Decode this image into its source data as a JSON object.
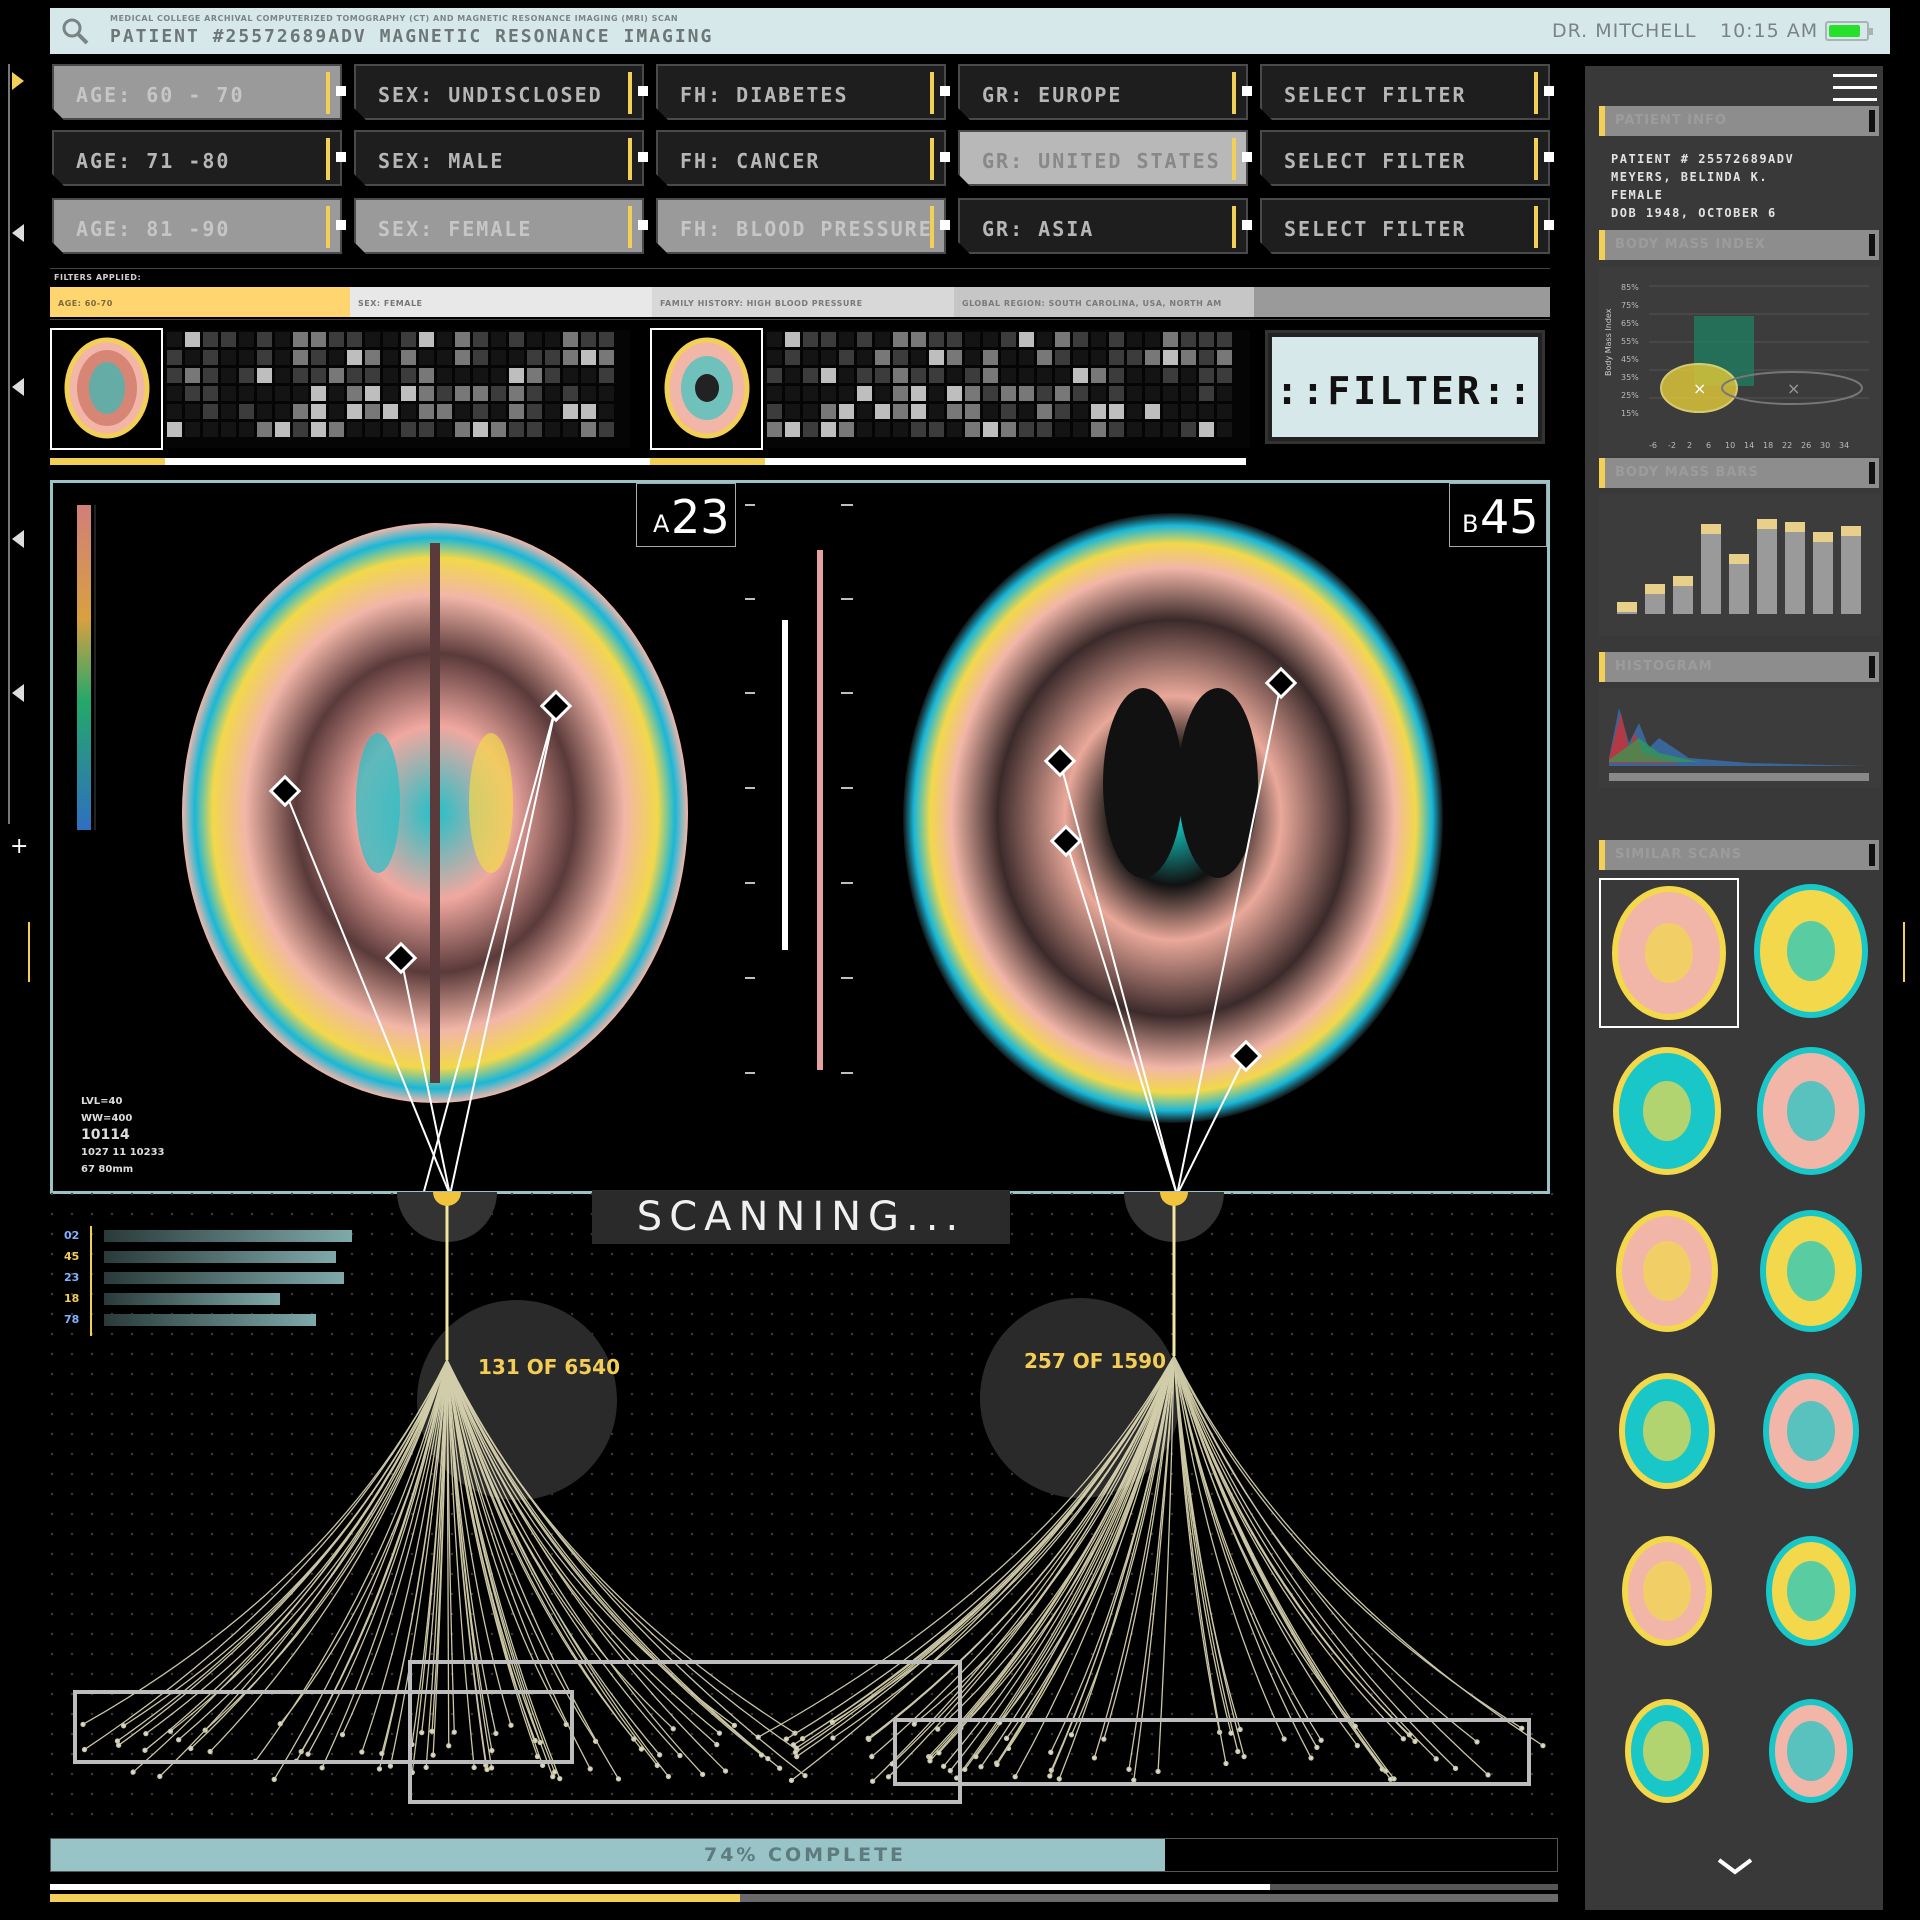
{
  "header": {
    "subtitle": "MEDICAL COLLEGE  ARCHIVAL COMPUTERIZED TOMOGRAPHY (CT) AND MAGNETIC RESONANCE IMAGING (MRI) SCAN",
    "title": "PATIENT #25572689ADV MAGNETIC RESONANCE IMAGING",
    "user": "DR. MITCHELL",
    "time": "10:15 AM",
    "battery_level": 0.85,
    "battery_color": "#27e02b"
  },
  "filters": {
    "row1": [
      "AGE: 60 - 70",
      "SEX: UNDISCLOSED",
      "FH: DIABETES",
      "GR: EUROPE",
      "SELECT FILTER"
    ],
    "row2": [
      "AGE: 71 -80",
      "SEX: MALE",
      "FH: CANCER",
      "GR: UNITED STATES",
      "SELECT FILTER"
    ],
    "row3": [
      "AGE: 81 -90",
      "SEX: FEMALE",
      "FH: BLOOD PRESSURE",
      "GR: ASIA",
      "SELECT FILTER"
    ]
  },
  "applied": {
    "label": "FILTERS APPLIED:",
    "items": [
      "AGE: 60-70",
      "SEX: FEMALE",
      "FAMILY HISTORY: HIGH BLOOD PRESSURE",
      "GLOBAL REGION: SOUTH CAROLINA, USA, NORTH AM"
    ]
  },
  "filter_button": "::FILTER::",
  "viewer": {
    "left_id": "23",
    "left_prefix": "A",
    "right_id": "45",
    "right_prefix": "B",
    "readout": [
      "LVL=40",
      "WW=400",
      "10114",
      "1027   11   10233",
      "67  80mm"
    ]
  },
  "scanning": "SCANNING...",
  "counts": {
    "left": "131 OF 6540",
    "right": "257 OF 1590"
  },
  "mini_bars": [
    "02",
    "45",
    "23",
    "18",
    "78"
  ],
  "mini_bar_values": [
    0.62,
    0.58,
    0.6,
    0.44,
    0.53
  ],
  "progress": {
    "text": "74% COMPLETE",
    "value": 0.74
  },
  "sidebar": {
    "patient": [
      "PATIENT # 25572689ADV",
      "MEYERS, BELINDA K.",
      "FEMALE",
      "DOB 1948, OCTOBER 6"
    ],
    "chart_y_label": "Body Mass Index",
    "y_ticks": [
      "85%",
      "75%",
      "65%",
      "55%",
      "45%",
      "35%",
      "25%",
      "15%"
    ],
    "x_ticks": [
      "-6",
      "-2",
      "2",
      "6",
      "10",
      "14",
      "18",
      "22",
      "26",
      "30",
      "34"
    ]
  },
  "colors": {
    "accent": "#f2cf56",
    "frame": "#98c4c8",
    "header_bg": "#d6e8ea"
  }
}
